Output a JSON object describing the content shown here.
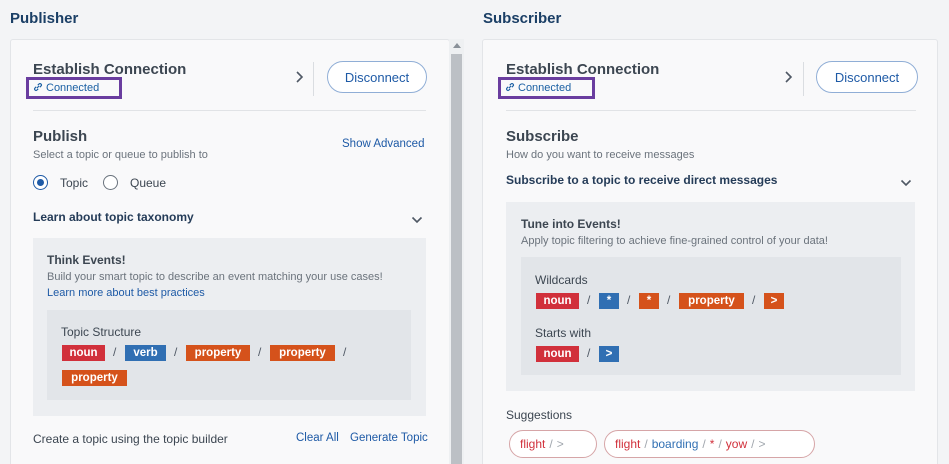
{
  "publisher": {
    "title": "Publisher",
    "connection": {
      "title": "Establish Connection",
      "status": "Connected",
      "disconnect_label": "Disconnect"
    },
    "publish": {
      "title": "Publish",
      "subtitle": "Select a topic or queue to publish to",
      "show_advanced": "Show Advanced",
      "radio_topic": "Topic",
      "radio_queue": "Queue",
      "selected": "Topic",
      "accordion": "Learn about topic taxonomy"
    },
    "think": {
      "title": "Think Events!",
      "text": "Build your smart topic to describe an event matching your use cases!",
      "link": "Learn more about best practices",
      "structure_title": "Topic Structure",
      "chips": [
        "noun",
        "verb",
        "property",
        "property",
        "property"
      ],
      "separator": "/"
    },
    "footer": {
      "text": "Create a topic using the topic builder",
      "clear": "Clear All",
      "generate": "Generate Topic"
    }
  },
  "subscriber": {
    "title": "Subscriber",
    "connection": {
      "title": "Establish Connection",
      "status": "Connected",
      "disconnect_label": "Disconnect"
    },
    "subscribe": {
      "title": "Subscribe",
      "subtitle": "How do you want to receive messages",
      "accordion": "Subscribe to a topic to receive direct messages"
    },
    "tune": {
      "title": "Tune into Events!",
      "text": "Apply topic filtering to achieve fine-grained control of your data!",
      "wildcards_title": "Wildcards",
      "wildcard_chips": [
        "noun",
        "*",
        "*",
        "property",
        ">"
      ],
      "starts_title": "Starts with",
      "starts_chips": [
        "noun",
        ">"
      ]
    },
    "suggestions": {
      "title": "Suggestions",
      "items": [
        {
          "parts": [
            "flight",
            "/",
            ">"
          ]
        },
        {
          "parts": [
            "flight",
            "/",
            "boarding",
            "/",
            "*",
            "/",
            "yow",
            "/",
            ">"
          ]
        }
      ]
    }
  },
  "colors": {
    "noun": "#d1303b",
    "verb": "#306fb3",
    "property": "#d5521b",
    "accent": "#1e5aa6",
    "highlight": "#6a3d9f"
  }
}
